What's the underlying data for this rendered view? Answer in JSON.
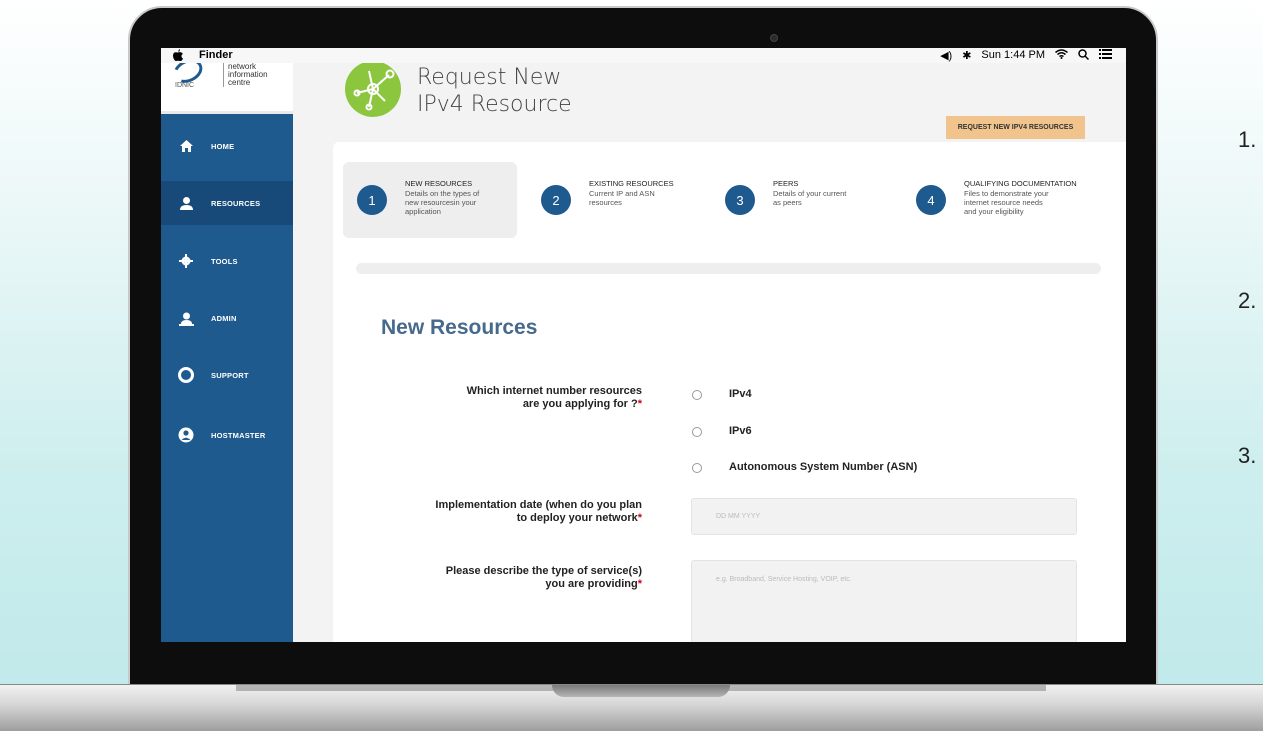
{
  "side_numbers": [
    "1.",
    "2.",
    "3."
  ],
  "menubar": {
    "app_name": "Finder",
    "time": "Sun 1:44 PM",
    "status_icons": [
      "volume-icon",
      "bluetooth-icon",
      "wifi-icon",
      "search-icon",
      "list-icon"
    ]
  },
  "logo": {
    "short": "IDNIC",
    "line1": "network",
    "line2": "information",
    "line3": "centre"
  },
  "sidebar": {
    "items": [
      {
        "label": "HOME",
        "icon": "home-icon",
        "active": false
      },
      {
        "label": "RESOURCES",
        "icon": "user-icon",
        "active": true
      },
      {
        "label": "TOOLS",
        "icon": "gear-icon",
        "active": false
      },
      {
        "label": "ADMIN",
        "icon": "admin-icon",
        "active": false
      },
      {
        "label": "SUPPORT",
        "icon": "lifebuoy-icon",
        "active": false
      },
      {
        "label": "HOSTMASTER",
        "icon": "account-circle-icon",
        "active": false
      }
    ]
  },
  "header": {
    "title": "Request New\nIPv4 Resource",
    "action_label": "REQUEST NEW IPV4 RESOURCES"
  },
  "steps": [
    {
      "number": "1",
      "title": "NEW RESOURCES",
      "desc": "Details on the types of\nnew resourcesin your\napplication",
      "active": true
    },
    {
      "number": "2",
      "title": "EXISTING RESOURCES",
      "desc": "Current IP and ASN\nresources",
      "active": false
    },
    {
      "number": "3",
      "title": "PEERS",
      "desc": "Details of your current\nas peers",
      "active": false
    },
    {
      "number": "4",
      "title": "QUALIFYING DOCUMENTATION",
      "desc": "Files to demonstrate your\ninternet resource needs\nand your eligibility",
      "active": false
    }
  ],
  "form": {
    "section_title": "New Resources",
    "q1": {
      "label": "Which internet number resources\nare you applying for ?",
      "required": "*"
    },
    "options": [
      "IPv4",
      "IPv6",
      "Autonomous System Number (ASN)"
    ],
    "q2": {
      "label": "Implementation date (when do you plan\nto deploy your network",
      "required": "*",
      "placeholder": "DD MM YYYY"
    },
    "q3": {
      "label": "Please describe the type of service(s)\nyou are providing",
      "required": "*",
      "placeholder": "e.g. Broadband, Service Hosting, VOIP, etc."
    }
  },
  "colors": {
    "sidebar": "#1f5a8f",
    "sidebar_active": "#174a78",
    "accent_green": "#8cc63f",
    "action_button": "#f0c48c",
    "section_title": "#456a8c",
    "required": "#d0021b"
  }
}
